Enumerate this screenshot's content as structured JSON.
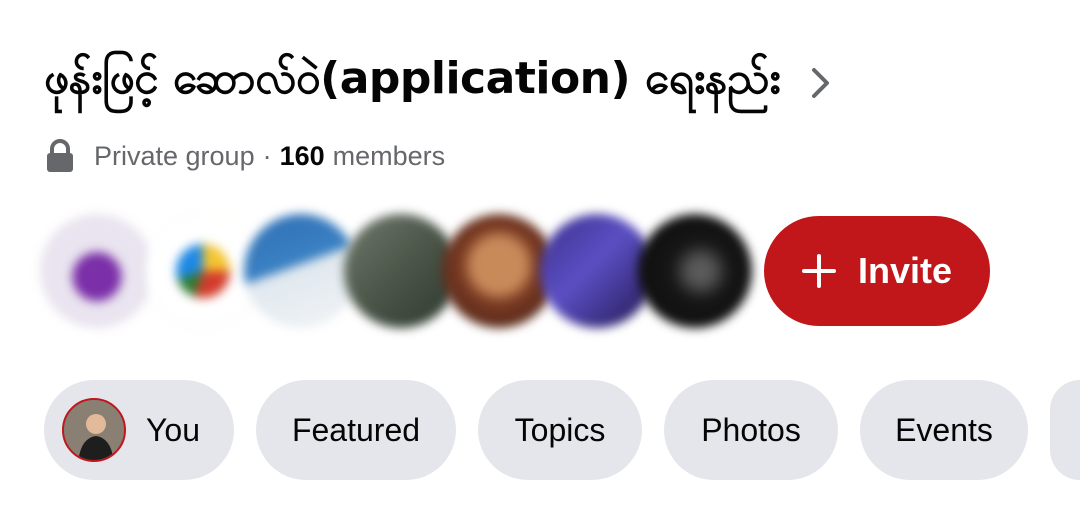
{
  "group": {
    "title": "ဖုန်းဖြင့် ဆောလ်ဝဲ(application) ရေးနည်း",
    "privacy": "Private group",
    "separator": "·",
    "member_count": "160",
    "members_label": "members"
  },
  "actions": {
    "invite_label": "Invite"
  },
  "avatars": [
    "member-1",
    "member-2",
    "member-3",
    "member-4",
    "member-5",
    "member-6",
    "member-7"
  ],
  "tabs": [
    {
      "label": "You"
    },
    {
      "label": "Featured"
    },
    {
      "label": "Topics"
    },
    {
      "label": "Photos"
    },
    {
      "label": "Events"
    }
  ],
  "colors": {
    "invite_bg": "#c1161a",
    "chip_bg": "#e4e6eb",
    "muted_text": "#65676b"
  },
  "icons": {
    "privacy": "lock-icon",
    "title_action": "chevron-right-icon",
    "invite": "plus-icon"
  }
}
